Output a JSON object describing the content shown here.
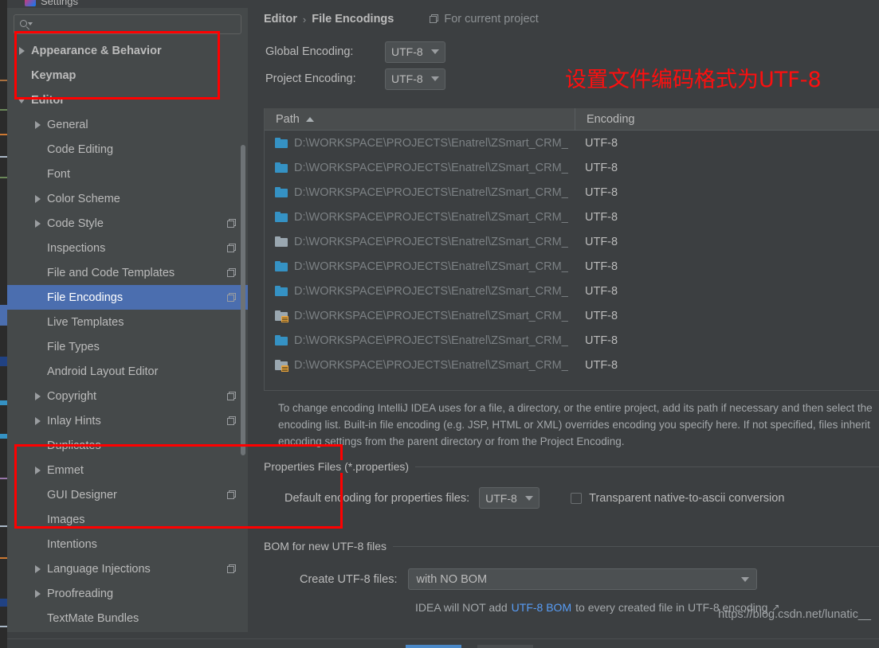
{
  "window": {
    "title": "Settings",
    "logo_icon": "intellij-logo-icon"
  },
  "sidebar": {
    "search": {
      "value": "",
      "placeholder": "",
      "icon": "search-icon"
    },
    "items": [
      {
        "label": "Appearance & Behavior",
        "indent": 0,
        "twisty": "closed",
        "bold": true,
        "copy": false,
        "selected": false
      },
      {
        "label": "Keymap",
        "indent": 0,
        "twisty": "none",
        "bold": true,
        "copy": false,
        "selected": false
      },
      {
        "label": "Editor",
        "indent": 0,
        "twisty": "open",
        "bold": true,
        "copy": false,
        "selected": false
      },
      {
        "label": "General",
        "indent": 1,
        "twisty": "closed",
        "bold": false,
        "copy": false,
        "selected": false
      },
      {
        "label": "Code Editing",
        "indent": 1,
        "twisty": "none",
        "bold": false,
        "copy": false,
        "selected": false
      },
      {
        "label": "Font",
        "indent": 1,
        "twisty": "none",
        "bold": false,
        "copy": false,
        "selected": false
      },
      {
        "label": "Color Scheme",
        "indent": 1,
        "twisty": "closed",
        "bold": false,
        "copy": false,
        "selected": false
      },
      {
        "label": "Code Style",
        "indent": 1,
        "twisty": "closed",
        "bold": false,
        "copy": true,
        "selected": false
      },
      {
        "label": "Inspections",
        "indent": 1,
        "twisty": "none",
        "bold": false,
        "copy": true,
        "selected": false
      },
      {
        "label": "File and Code Templates",
        "indent": 1,
        "twisty": "none",
        "bold": false,
        "copy": true,
        "selected": false
      },
      {
        "label": "File Encodings",
        "indent": 1,
        "twisty": "none",
        "bold": false,
        "copy": true,
        "selected": true
      },
      {
        "label": "Live Templates",
        "indent": 1,
        "twisty": "none",
        "bold": false,
        "copy": false,
        "selected": false
      },
      {
        "label": "File Types",
        "indent": 1,
        "twisty": "none",
        "bold": false,
        "copy": false,
        "selected": false
      },
      {
        "label": "Android Layout Editor",
        "indent": 1,
        "twisty": "none",
        "bold": false,
        "copy": false,
        "selected": false
      },
      {
        "label": "Copyright",
        "indent": 1,
        "twisty": "closed",
        "bold": false,
        "copy": true,
        "selected": false
      },
      {
        "label": "Inlay Hints",
        "indent": 1,
        "twisty": "closed",
        "bold": false,
        "copy": true,
        "selected": false
      },
      {
        "label": "Duplicates",
        "indent": 1,
        "twisty": "none",
        "bold": false,
        "copy": false,
        "selected": false
      },
      {
        "label": "Emmet",
        "indent": 1,
        "twisty": "closed",
        "bold": false,
        "copy": false,
        "selected": false
      },
      {
        "label": "GUI Designer",
        "indent": 1,
        "twisty": "none",
        "bold": false,
        "copy": true,
        "selected": false
      },
      {
        "label": "Images",
        "indent": 1,
        "twisty": "none",
        "bold": false,
        "copy": false,
        "selected": false
      },
      {
        "label": "Intentions",
        "indent": 1,
        "twisty": "none",
        "bold": false,
        "copy": false,
        "selected": false
      },
      {
        "label": "Language Injections",
        "indent": 1,
        "twisty": "closed",
        "bold": false,
        "copy": true,
        "selected": false
      },
      {
        "label": "Proofreading",
        "indent": 1,
        "twisty": "closed",
        "bold": false,
        "copy": false,
        "selected": false
      },
      {
        "label": "TextMate Bundles",
        "indent": 1,
        "twisty": "none",
        "bold": false,
        "copy": false,
        "selected": false
      }
    ]
  },
  "breadcrumb": {
    "parent": "Editor",
    "separator": "›",
    "current": "File Encodings",
    "scope_label": "For current project",
    "scope_icon": "copy-scope-icon"
  },
  "encoding": {
    "global_label": "Global Encoding:",
    "global_value": "UTF-8",
    "project_label": "Project Encoding:",
    "project_value": "UTF-8"
  },
  "annotation": {
    "text": "设置文件编码格式为UTF-8",
    "color": "#fd0f0f"
  },
  "table": {
    "columns": [
      "Path",
      "Encoding"
    ],
    "sort_column": "Path",
    "sort_direction": "asc",
    "rows": [
      {
        "icon": "folder-blue-icon",
        "path": "D:\\WORKSPACE\\PROJECTS\\Enatrel\\ZSmart_CRM_",
        "encoding": "UTF-8"
      },
      {
        "icon": "folder-blue-icon",
        "path": "D:\\WORKSPACE\\PROJECTS\\Enatrel\\ZSmart_CRM_",
        "encoding": "UTF-8"
      },
      {
        "icon": "folder-blue-icon",
        "path": "D:\\WORKSPACE\\PROJECTS\\Enatrel\\ZSmart_CRM_",
        "encoding": "UTF-8"
      },
      {
        "icon": "folder-blue-icon",
        "path": "D:\\WORKSPACE\\PROJECTS\\Enatrel\\ZSmart_CRM_",
        "encoding": "UTF-8"
      },
      {
        "icon": "folder-gray-icon",
        "path": "D:\\WORKSPACE\\PROJECTS\\Enatrel\\ZSmart_CRM_",
        "encoding": "UTF-8"
      },
      {
        "icon": "folder-blue-icon",
        "path": "D:\\WORKSPACE\\PROJECTS\\Enatrel\\ZSmart_CRM_",
        "encoding": "UTF-8"
      },
      {
        "icon": "folder-blue-icon",
        "path": "D:\\WORKSPACE\\PROJECTS\\Enatrel\\ZSmart_CRM_",
        "encoding": "UTF-8"
      },
      {
        "icon": "folder-source-icon",
        "path": "D:\\WORKSPACE\\PROJECTS\\Enatrel\\ZSmart_CRM_",
        "encoding": "UTF-8"
      },
      {
        "icon": "folder-blue-icon",
        "path": "D:\\WORKSPACE\\PROJECTS\\Enatrel\\ZSmart_CRM_",
        "encoding": "UTF-8"
      },
      {
        "icon": "folder-source-icon",
        "path": "D:\\WORKSPACE\\PROJECTS\\Enatrel\\ZSmart_CRM_",
        "encoding": "UTF-8"
      }
    ]
  },
  "help_text": "To change encoding IntelliJ IDEA uses for a file, a directory, or the entire project, add its path if necessary and then select the encoding list. Built-in file encoding (e.g. JSP, HTML or XML) overrides encoding you specify here. If not specified, files inherit encoding settings from the parent directory or from the Project Encoding.",
  "properties_group": {
    "title": "Properties Files (*.properties)",
    "default_encoding_label": "Default encoding for properties files:",
    "default_encoding_value": "UTF-8",
    "transparent_label": "Transparent native-to-ascii conversion",
    "transparent_checked": false
  },
  "bom_group": {
    "title": "BOM for new UTF-8 files",
    "create_label": "Create UTF-8 files:",
    "create_value": "with NO BOM",
    "note_prefix": "IDEA will NOT add ",
    "note_link": "UTF-8 BOM",
    "note_suffix": " to every created file in UTF-8 encoding",
    "external_arrow": "↗"
  },
  "watermark": "https://blog.csdn.net/lunatic__"
}
